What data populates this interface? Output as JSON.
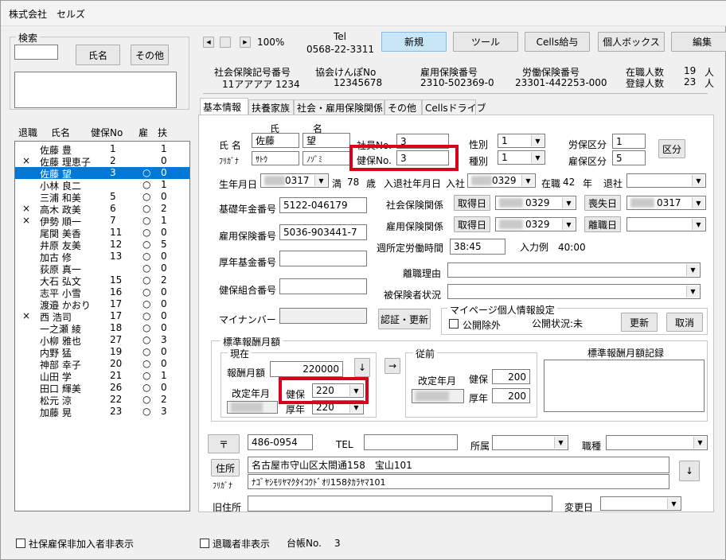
{
  "window": {
    "title": "株式会社　セルズ"
  },
  "search": {
    "group_title": "検索",
    "name_button": "氏名",
    "other_button": "その他"
  },
  "list": {
    "headers": {
      "retired": "退職",
      "name": "氏名",
      "kenpo_no": "健保No",
      "employ": "雇",
      "dependents": "扶"
    },
    "rows": [
      {
        "retired": "",
        "name": "佐藤 豊",
        "no": "1",
        "employ": "",
        "dep": "1"
      },
      {
        "retired": "×",
        "name": "佐藤 理恵子",
        "no": "2",
        "employ": "",
        "dep": "0"
      },
      {
        "retired": "",
        "name": "佐藤 望",
        "no": "3",
        "employ": "○",
        "dep": "0"
      },
      {
        "retired": "",
        "name": "小林 良二",
        "no": "",
        "employ": "○",
        "dep": "1"
      },
      {
        "retired": "",
        "name": "三浦 和美",
        "no": "5",
        "employ": "○",
        "dep": "0"
      },
      {
        "retired": "×",
        "name": "高木 政美",
        "no": "6",
        "employ": "○",
        "dep": "2"
      },
      {
        "retired": "×",
        "name": "伊勢 順一",
        "no": "7",
        "employ": "○",
        "dep": "1"
      },
      {
        "retired": "",
        "name": "尾関 美香",
        "no": "11",
        "employ": "○",
        "dep": "0"
      },
      {
        "retired": "",
        "name": "井原 友美",
        "no": "12",
        "employ": "○",
        "dep": "5"
      },
      {
        "retired": "",
        "name": "加古 修",
        "no": "13",
        "employ": "○",
        "dep": "0"
      },
      {
        "retired": "",
        "name": "荻原 真一",
        "no": "",
        "employ": "○",
        "dep": "0"
      },
      {
        "retired": "",
        "name": "大石 弘文",
        "no": "15",
        "employ": "○",
        "dep": "2"
      },
      {
        "retired": "",
        "name": "志平 小雪",
        "no": "16",
        "employ": "○",
        "dep": "0"
      },
      {
        "retired": "",
        "name": "渡邉 かおり",
        "no": "17",
        "employ": "○",
        "dep": "0"
      },
      {
        "retired": "×",
        "name": "西 浩司",
        "no": "17",
        "employ": "○",
        "dep": "0"
      },
      {
        "retired": "",
        "name": "一之瀬 綾",
        "no": "18",
        "employ": "○",
        "dep": "0"
      },
      {
        "retired": "",
        "name": "小柳 雅也",
        "no": "27",
        "employ": "○",
        "dep": "3"
      },
      {
        "retired": "",
        "name": "内野 猛",
        "no": "19",
        "employ": "○",
        "dep": "0"
      },
      {
        "retired": "",
        "name": "神部 幸子",
        "no": "20",
        "employ": "○",
        "dep": "0"
      },
      {
        "retired": "",
        "name": "山田 学",
        "no": "21",
        "employ": "○",
        "dep": "1"
      },
      {
        "retired": "",
        "name": "田口 輝美",
        "no": "26",
        "employ": "○",
        "dep": "0"
      },
      {
        "retired": "",
        "name": "松元 涼",
        "no": "22",
        "employ": "○",
        "dep": "2"
      },
      {
        "retired": "",
        "name": "加藤 晃",
        "no": "23",
        "employ": "○",
        "dep": "3"
      }
    ],
    "selected_index": 2,
    "hide_unenrolled": "社保雇保非加入者非表示"
  },
  "toolbar": {
    "zoom": "100%",
    "tel_label": "Tel",
    "tel_value": "0568-22-3311",
    "new": "新規",
    "tools": "ツール",
    "cells_salary": "Cells給与",
    "personal_box": "個人ボックス",
    "edit": "編集"
  },
  "company": {
    "shaho_label": "社会保険記号番号",
    "shaho_value": "11アアアア 1234",
    "kyokai_label": "協会けんぽNo",
    "kyokai_value": "12345678",
    "koyo_label": "雇用保険番号",
    "koyo_value": "2310-502369-0",
    "rodo_label": "労働保険番号",
    "rodo_value": "23301-442253-000",
    "enrolled_label": "在職人数",
    "enrolled_value": "19",
    "registered_label": "登録人数",
    "registered_value": "23",
    "unit": "人"
  },
  "tabs": [
    "基本情報",
    "扶養家族",
    "社会・雇用保険関係",
    "その他",
    "Cellsドライブ"
  ],
  "basic": {
    "name_label": "氏 名",
    "furigana_label": "ﾌﾘｶﾞﾅ",
    "sei_label": "氏",
    "mei_label": "名",
    "sei": "佐藤",
    "mei": "望",
    "sei_kana": "ｻﾄｳ",
    "mei_kana": "ﾉｿﾞﾐ",
    "employee_no_label": "社員No.",
    "employee_no": "3",
    "kenpo_no_label": "健保No.",
    "kenpo_no": "3",
    "gender_label": "性別",
    "gender": "1",
    "type_label": "種別",
    "type": "1",
    "rodo_label": "労保区分",
    "rodo": "1",
    "koyo_label": "雇保区分",
    "koyo": "5",
    "kubun_button": "区分",
    "birth_label": "生年月日",
    "birth": "0317",
    "age_prefix": "満",
    "age": "78",
    "age_suffix": "歳",
    "join_label": "入退社年月日",
    "join_prefix": "入社",
    "join": "0329",
    "tenure_prefix": "在職",
    "tenure": "42",
    "tenure_suffix": "年",
    "retire_prefix": "退社",
    "pension_label": "基礎年金番号",
    "pension": "5122-046179",
    "koyo_no_label": "雇用保険番号",
    "koyo_no": "5036-903441-7",
    "kosei_label": "厚年基金番号",
    "kenpo_kumiai_label": "健保組合番号",
    "mynumber_label": "マイナンバー",
    "auth_button": "認証・更新",
    "shaho_rel_label": "社会保険関係",
    "acquire_button": "取得日",
    "shaho_acquire": "0329",
    "lose_button": "喪失日",
    "shaho_lose": "0317",
    "koyo_rel_label": "雇用保険関係",
    "koyo_acquire": "0329",
    "leave_button": "離職日",
    "work_hours_label": "週所定労働時間",
    "work_hours": "38:45",
    "work_hours_example": "入力例　40:00",
    "leave_reason_label": "離職理由",
    "insured_status_label": "被保険者状況",
    "mypage_title": "マイページ個人情報設定",
    "public_exclude": "公開除外",
    "public_status": "公開状況:未",
    "update_button": "更新",
    "cancel_button": "取消"
  },
  "salary": {
    "group_title": "標準報酬月額",
    "current_title": "現在",
    "monthly_label": "報酬月額",
    "monthly": "220000",
    "revised_label": "改定年月",
    "kenpo_label": "健保",
    "kenpo": "220",
    "kosei_label": "厚年",
    "kosei": "220",
    "prev_title": "従前",
    "prev_revised_label": "改定年月",
    "prev_kenpo": "200",
    "prev_kosei": "200",
    "record_title": "標準報酬月額記録"
  },
  "address": {
    "postal_button": "〒",
    "postal": "486-0954",
    "tel_label": "TEL",
    "affiliation_label": "所属",
    "job_label": "職種",
    "address_button": "住所",
    "furigana_label": "ﾌﾘｶﾞﾅ",
    "address": "名古屋市守山区太閤通158　宝山101",
    "address_kana": "ﾅｺﾞﾔｼﾓﾘﾔﾏｸﾀｲｺｳﾄﾞｵﾘ158ﾀｶﾗﾔﾏ101",
    "old_address_label": "旧住所",
    "change_date_label": "変更日"
  },
  "footer": {
    "hide_retired": "退職者非表示",
    "ledger_label": "台帳No.",
    "ledger_value": "3"
  }
}
